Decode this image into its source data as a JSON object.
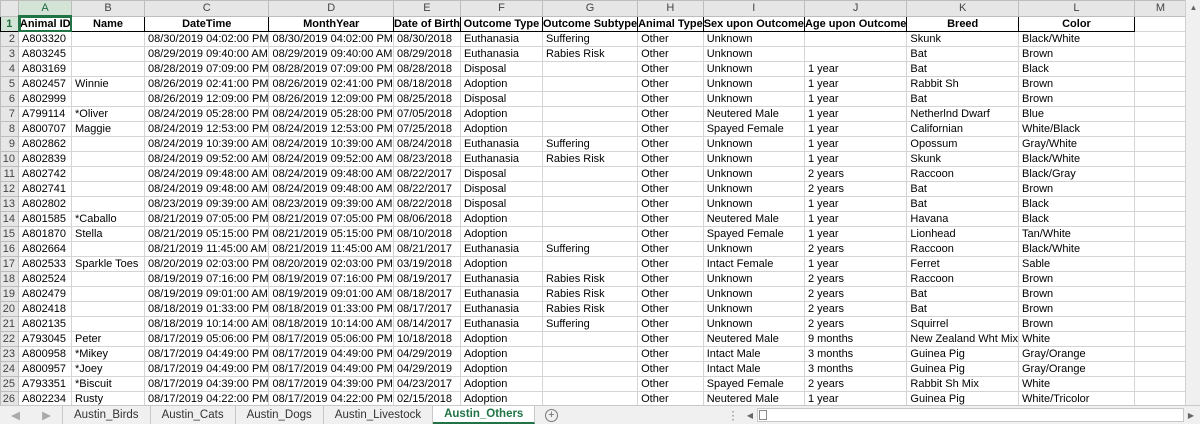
{
  "columns": [
    "A",
    "B",
    "C",
    "D",
    "E",
    "F",
    "G",
    "H",
    "I",
    "J",
    "K",
    "L",
    "M"
  ],
  "active_column": "A",
  "headers": [
    "Animal ID",
    "Name",
    "DateTime",
    "MonthYear",
    "Date of Birth",
    "Outcome Type",
    "Outcome Subtype",
    "Animal Type",
    "Sex upon Outcome",
    "Age upon Outcome",
    "Breed",
    "Color"
  ],
  "rows": [
    [
      "A803320",
      "",
      "08/30/2019 04:02:00 PM",
      "08/30/2019 04:02:00 PM",
      "08/30/2018",
      "Euthanasia",
      "Suffering",
      "Other",
      "Unknown",
      "",
      "Skunk",
      "Black/White"
    ],
    [
      "A803245",
      "",
      "08/29/2019 09:40:00 AM",
      "08/29/2019 09:40:00 AM",
      "08/29/2018",
      "Euthanasia",
      "Rabies Risk",
      "Other",
      "Unknown",
      "",
      "Bat",
      "Brown"
    ],
    [
      "A803169",
      "",
      "08/28/2019 07:09:00 PM",
      "08/28/2019 07:09:00 PM",
      "08/28/2018",
      "Disposal",
      "",
      "Other",
      "Unknown",
      "1 year",
      "Bat",
      "Black"
    ],
    [
      "A802457",
      "Winnie",
      "08/26/2019 02:41:00 PM",
      "08/26/2019 02:41:00 PM",
      "08/18/2018",
      "Adoption",
      "",
      "Other",
      "Unknown",
      "1 year",
      "Rabbit Sh",
      "Brown"
    ],
    [
      "A802999",
      "",
      "08/26/2019 12:09:00 PM",
      "08/26/2019 12:09:00 PM",
      "08/25/2018",
      "Disposal",
      "",
      "Other",
      "Unknown",
      "1 year",
      "Bat",
      "Brown"
    ],
    [
      "A799114",
      "*Oliver",
      "08/24/2019 05:28:00 PM",
      "08/24/2019 05:28:00 PM",
      "07/05/2018",
      "Adoption",
      "",
      "Other",
      "Neutered Male",
      "1 year",
      "Netherlnd Dwarf",
      "Blue"
    ],
    [
      "A800707",
      "Maggie",
      "08/24/2019 12:53:00 PM",
      "08/24/2019 12:53:00 PM",
      "07/25/2018",
      "Adoption",
      "",
      "Other",
      "Spayed Female",
      "1 year",
      "Californian",
      "White/Black"
    ],
    [
      "A802862",
      "",
      "08/24/2019 10:39:00 AM",
      "08/24/2019 10:39:00 AM",
      "08/24/2018",
      "Euthanasia",
      "Suffering",
      "Other",
      "Unknown",
      "1 year",
      "Opossum",
      "Gray/White"
    ],
    [
      "A802839",
      "",
      "08/24/2019 09:52:00 AM",
      "08/24/2019 09:52:00 AM",
      "08/23/2018",
      "Euthanasia",
      "Rabies Risk",
      "Other",
      "Unknown",
      "1 year",
      "Skunk",
      "Black/White"
    ],
    [
      "A802742",
      "",
      "08/24/2019 09:48:00 AM",
      "08/24/2019 09:48:00 AM",
      "08/22/2017",
      "Disposal",
      "",
      "Other",
      "Unknown",
      "2 years",
      "Raccoon",
      "Black/Gray"
    ],
    [
      "A802741",
      "",
      "08/24/2019 09:48:00 AM",
      "08/24/2019 09:48:00 AM",
      "08/22/2017",
      "Disposal",
      "",
      "Other",
      "Unknown",
      "2 years",
      "Bat",
      "Brown"
    ],
    [
      "A802802",
      "",
      "08/23/2019 09:39:00 AM",
      "08/23/2019 09:39:00 AM",
      "08/22/2018",
      "Disposal",
      "",
      "Other",
      "Unknown",
      "1 year",
      "Bat",
      "Black"
    ],
    [
      "A801585",
      "*Caballo",
      "08/21/2019 07:05:00 PM",
      "08/21/2019 07:05:00 PM",
      "08/06/2018",
      "Adoption",
      "",
      "Other",
      "Neutered Male",
      "1 year",
      "Havana",
      "Black"
    ],
    [
      "A801870",
      "Stella",
      "08/21/2019 05:15:00 PM",
      "08/21/2019 05:15:00 PM",
      "08/10/2018",
      "Adoption",
      "",
      "Other",
      "Spayed Female",
      "1 year",
      "Lionhead",
      "Tan/White"
    ],
    [
      "A802664",
      "",
      "08/21/2019 11:45:00 AM",
      "08/21/2019 11:45:00 AM",
      "08/21/2017",
      "Euthanasia",
      "Suffering",
      "Other",
      "Unknown",
      "2 years",
      "Raccoon",
      "Black/White"
    ],
    [
      "A802533",
      "Sparkle Toes",
      "08/20/2019 02:03:00 PM",
      "08/20/2019 02:03:00 PM",
      "03/19/2018",
      "Adoption",
      "",
      "Other",
      "Intact Female",
      "1 year",
      "Ferret",
      "Sable"
    ],
    [
      "A802524",
      "",
      "08/19/2019 07:16:00 PM",
      "08/19/2019 07:16:00 PM",
      "08/19/2017",
      "Euthanasia",
      "Rabies Risk",
      "Other",
      "Unknown",
      "2 years",
      "Raccoon",
      "Brown"
    ],
    [
      "A802479",
      "",
      "08/19/2019 09:01:00 AM",
      "08/19/2019 09:01:00 AM",
      "08/18/2017",
      "Euthanasia",
      "Rabies Risk",
      "Other",
      "Unknown",
      "2 years",
      "Bat",
      "Brown"
    ],
    [
      "A802418",
      "",
      "08/18/2019 01:33:00 PM",
      "08/18/2019 01:33:00 PM",
      "08/17/2017",
      "Euthanasia",
      "Rabies Risk",
      "Other",
      "Unknown",
      "2 years",
      "Bat",
      "Brown"
    ],
    [
      "A802135",
      "",
      "08/18/2019 10:14:00 AM",
      "08/18/2019 10:14:00 AM",
      "08/14/2017",
      "Euthanasia",
      "Suffering",
      "Other",
      "Unknown",
      "2 years",
      "Squirrel",
      "Brown"
    ],
    [
      "A793045",
      "Peter",
      "08/17/2019 05:06:00 PM",
      "08/17/2019 05:06:00 PM",
      "10/18/2018",
      "Adoption",
      "",
      "Other",
      "Neutered Male",
      "9 months",
      "New Zealand Wht Mix",
      "White"
    ],
    [
      "A800958",
      "*Mikey",
      "08/17/2019 04:49:00 PM",
      "08/17/2019 04:49:00 PM",
      "04/29/2019",
      "Adoption",
      "",
      "Other",
      "Intact Male",
      "3 months",
      "Guinea Pig",
      "Gray/Orange"
    ],
    [
      "A800957",
      "*Joey",
      "08/17/2019 04:49:00 PM",
      "08/17/2019 04:49:00 PM",
      "04/29/2019",
      "Adoption",
      "",
      "Other",
      "Intact Male",
      "3 months",
      "Guinea Pig",
      "Gray/Orange"
    ],
    [
      "A793351",
      "*Biscuit",
      "08/17/2019 04:39:00 PM",
      "08/17/2019 04:39:00 PM",
      "04/23/2017",
      "Adoption",
      "",
      "Other",
      "Spayed Female",
      "2 years",
      "Rabbit Sh Mix",
      "White"
    ],
    [
      "A802234",
      "Rusty",
      "08/17/2019 04:22:00 PM",
      "08/17/2019 04:22:00 PM",
      "02/15/2018",
      "Adoption",
      "",
      "Other",
      "Neutered Male",
      "1 year",
      "Guinea Pig",
      "White/Tricolor"
    ]
  ],
  "sheet_tabs": [
    "Austin_Birds",
    "Austin_Cats",
    "Austin_Dogs",
    "Austin_Livestock",
    "Austin_Others"
  ],
  "active_tab": "Austin_Others",
  "icons": {
    "add_sheet": "plus-circle-icon",
    "prev_sheet": "triangle-left-icon",
    "next_sheet": "triangle-right-icon"
  }
}
